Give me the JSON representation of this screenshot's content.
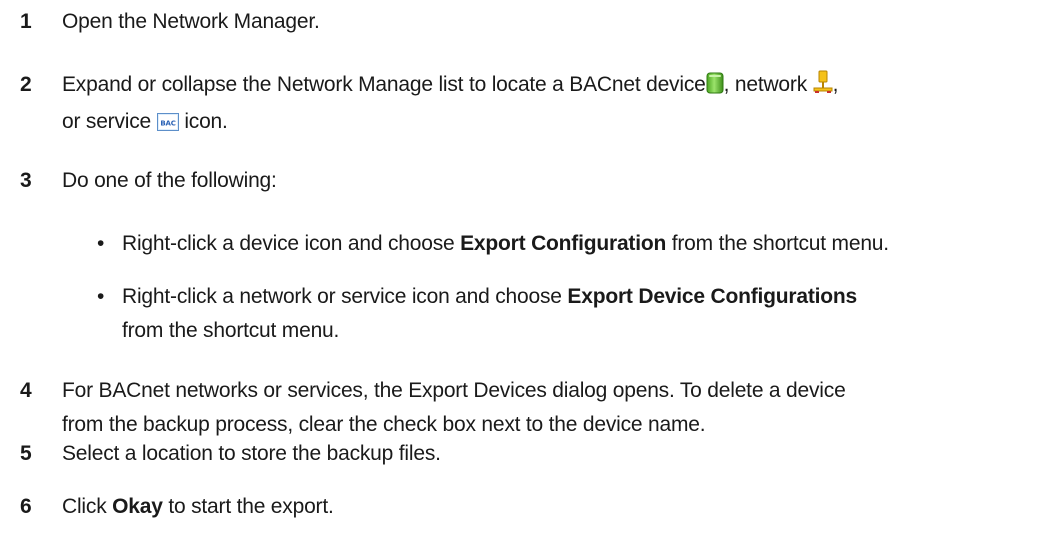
{
  "steps": [
    {
      "num": "1",
      "text": "Open the Network Manager."
    },
    {
      "num": "2",
      "text_a": "Expand or collapse the Network Manage list to locate a BACnet device",
      "text_b": ", network",
      "text_c": ",",
      "text_d": "or service",
      "text_e": "icon.",
      "icons": [
        "device-icon",
        "network-icon",
        "service-icon"
      ],
      "service_icon_label": "BAC"
    },
    {
      "num": "3",
      "text": "Do one of the following:"
    },
    {
      "num": "4",
      "text_a": "For BACnet networks or services, the Export Devices dialog opens. To delete a device",
      "text_b": "from the backup process, clear the check box next to the device name."
    },
    {
      "num": "5",
      "text": "Select a location to store the backup files."
    },
    {
      "num": "6",
      "text_a": "Click",
      "bold": "Okay",
      "text_b": "to start the export."
    }
  ],
  "bullets": [
    {
      "dot": "•",
      "text_a": "Right-click a device icon and choose",
      "bold": "Export Configuration",
      "text_b": "from the shortcut menu."
    },
    {
      "dot": "•",
      "text_a": "Right-click a network or service icon and choose",
      "bold": "Export Device Configurations",
      "text_b": "from the shortcut menu."
    }
  ],
  "colors": {
    "device_icon": "#6cc23a",
    "network_icon": "#e0a200",
    "service_icon": "#3b7fd4"
  }
}
